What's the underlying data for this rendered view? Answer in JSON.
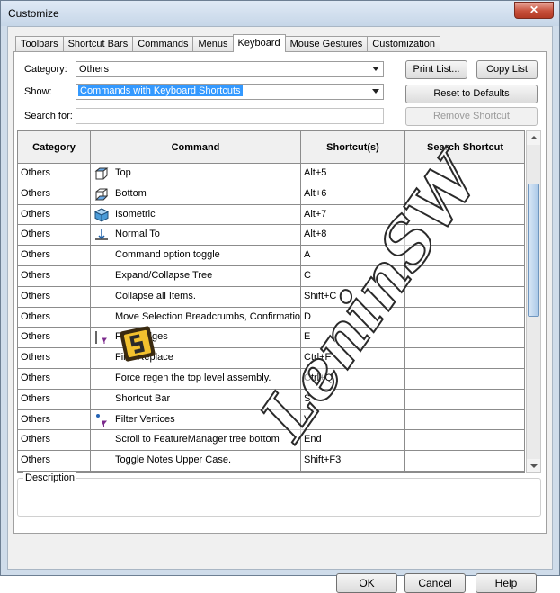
{
  "window": {
    "title": "Customize",
    "close_label": "✕"
  },
  "tabs": [
    "Toolbars",
    "Shortcut Bars",
    "Commands",
    "Menus",
    "Keyboard",
    "Mouse Gestures",
    "Customization"
  ],
  "active_tab": "Keyboard",
  "filters": {
    "category_label": "Category:",
    "category_value": "Others",
    "show_label": "Show:",
    "show_value": "Commands with Keyboard Shortcuts",
    "search_label": "Search for:",
    "search_value": ""
  },
  "buttons": {
    "print_list": "Print List...",
    "copy_list": "Copy List",
    "reset_defaults": "Reset to Defaults",
    "remove_shortcut": "Remove Shortcut"
  },
  "table": {
    "headers": [
      "Category",
      "Command",
      "Shortcut(s)",
      "Search Shortcut"
    ],
    "rows": [
      {
        "category": "Others",
        "command": "Top",
        "shortcut": "Alt+5",
        "search": "",
        "icon": "top-view-icon"
      },
      {
        "category": "Others",
        "command": "Bottom",
        "shortcut": "Alt+6",
        "search": "",
        "icon": "bottom-view-icon"
      },
      {
        "category": "Others",
        "command": "Isometric",
        "shortcut": "Alt+7",
        "search": "",
        "icon": "isometric-view-icon"
      },
      {
        "category": "Others",
        "command": "Normal To",
        "shortcut": "Alt+8",
        "search": "",
        "icon": "normal-to-icon"
      },
      {
        "category": "Others",
        "command": "Command option toggle",
        "shortcut": "A",
        "search": "",
        "icon": ""
      },
      {
        "category": "Others",
        "command": "Expand/Collapse Tree",
        "shortcut": "C",
        "search": "",
        "icon": ""
      },
      {
        "category": "Others",
        "command": "Collapse all Items.",
        "shortcut": "Shift+C",
        "search": "",
        "icon": ""
      },
      {
        "category": "Others",
        "command": "Move Selection Breadcrumbs, Confirmatio",
        "shortcut": "D",
        "search": "",
        "icon": ""
      },
      {
        "category": "Others",
        "command": "Filter Edges",
        "shortcut": "E",
        "search": "",
        "icon": "filter-edges-icon"
      },
      {
        "category": "Others",
        "command": "Find/Replace",
        "shortcut": "Ctrl+F",
        "search": "",
        "icon": ""
      },
      {
        "category": "Others",
        "command": "Force regen the top level assembly.",
        "shortcut": "Ctrl+Q",
        "search": "",
        "icon": ""
      },
      {
        "category": "Others",
        "command": "Shortcut Bar",
        "shortcut": "S",
        "search": "",
        "icon": ""
      },
      {
        "category": "Others",
        "command": "Filter Vertices",
        "shortcut": "V",
        "search": "",
        "icon": "filter-vertices-icon"
      },
      {
        "category": "Others",
        "command": "Scroll to FeatureManager tree bottom",
        "shortcut": "End",
        "search": "",
        "icon": ""
      },
      {
        "category": "Others",
        "command": "Toggle Notes Upper Case.",
        "shortcut": "Shift+F3",
        "search": "",
        "icon": ""
      }
    ]
  },
  "description_label": "Description",
  "watermark": "LeninSW",
  "footer": {
    "ok": "OK",
    "cancel": "Cancel",
    "help": "Help"
  },
  "colors": {
    "selection": "#3399ff",
    "frame": "#cfdcea",
    "close": "#c7503b"
  }
}
